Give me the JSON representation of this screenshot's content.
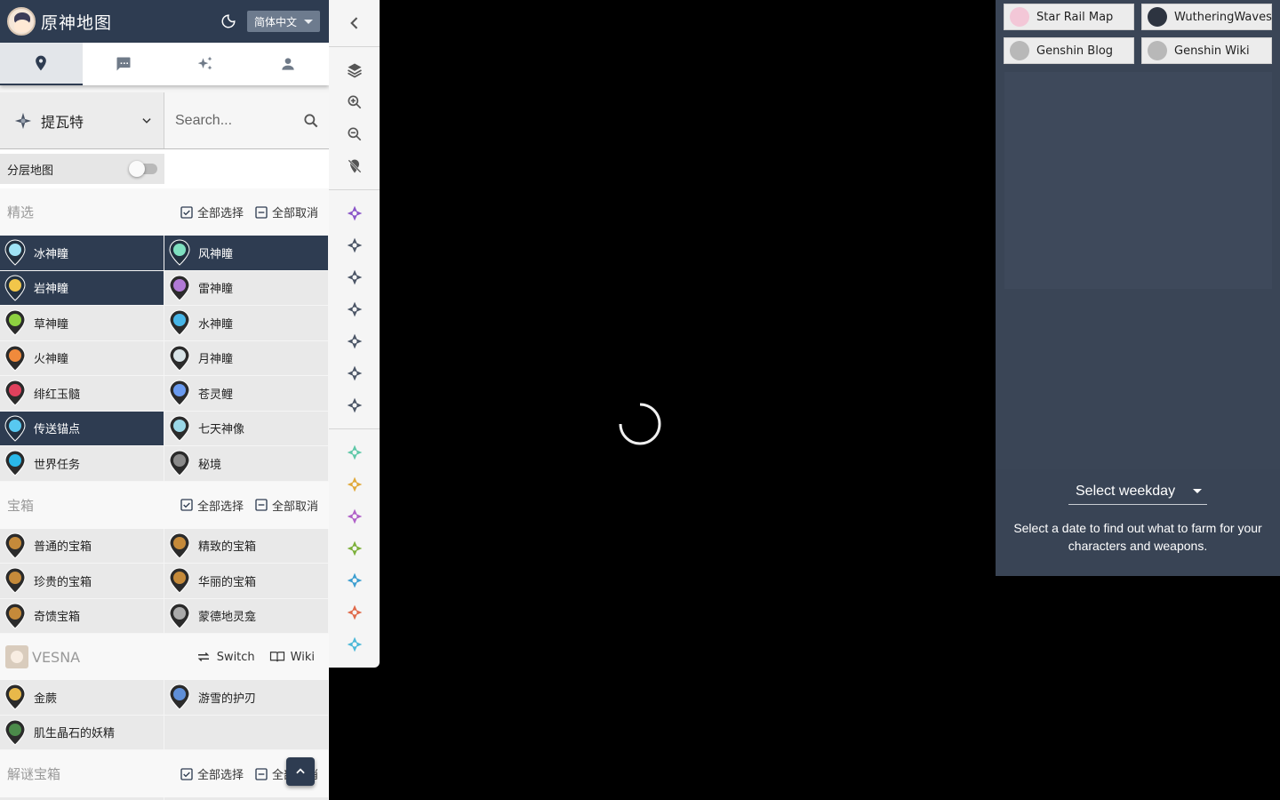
{
  "app": {
    "title": "原神地图",
    "language": "简体中文"
  },
  "tabs": [
    {
      "name": "map-pin-icon",
      "active": true
    },
    {
      "name": "chat-icon",
      "active": false
    },
    {
      "name": "sparkle-icon",
      "active": false
    },
    {
      "name": "user-icon",
      "active": false
    }
  ],
  "region": {
    "name": "提瓦特"
  },
  "search": {
    "placeholder": "Search..."
  },
  "layer_toggle": {
    "label": "分层地图",
    "on": false
  },
  "sections": {
    "featured": {
      "title": "精选",
      "select_all": "全部选择",
      "deselect_all": "全部取消",
      "items": [
        {
          "label": "冰神瞳",
          "on": true,
          "color": "#9fe3f5"
        },
        {
          "label": "风神瞳",
          "on": true,
          "color": "#7fe0c0"
        },
        {
          "label": "岩神瞳",
          "on": true,
          "color": "#f2c64a"
        },
        {
          "label": "雷神瞳",
          "on": false,
          "color": "#b17ad6"
        },
        {
          "label": "草神瞳",
          "on": false,
          "color": "#8ed140"
        },
        {
          "label": "水神瞳",
          "on": false,
          "color": "#47b6e8"
        },
        {
          "label": "火神瞳",
          "on": false,
          "color": "#f08a3c"
        },
        {
          "label": "月神瞳",
          "on": false,
          "color": "#d8e4e8"
        },
        {
          "label": "绯红玉髓",
          "on": false,
          "color": "#e0415d"
        },
        {
          "label": "苍灵鲤",
          "on": false,
          "color": "#6a9bf0"
        },
        {
          "label": "传送锚点",
          "on": true,
          "color": "#58c8f0"
        },
        {
          "label": "七天神像",
          "on": false,
          "color": "#9ad8e8"
        },
        {
          "label": "世界任务",
          "on": false,
          "color": "#2ab8e8"
        },
        {
          "label": "秘境",
          "on": false,
          "color": "#8a8a8a"
        }
      ]
    },
    "chests": {
      "title": "宝箱",
      "select_all": "全部选择",
      "deselect_all": "全部取消",
      "items": [
        {
          "label": "普通的宝箱",
          "on": false,
          "color": "#c58a3a"
        },
        {
          "label": "精致的宝箱",
          "on": false,
          "color": "#c58a3a"
        },
        {
          "label": "珍贵的宝箱",
          "on": false,
          "color": "#c58a3a"
        },
        {
          "label": "华丽的宝箱",
          "on": false,
          "color": "#c58a3a"
        },
        {
          "label": "奇馈宝箱",
          "on": false,
          "color": "#c58a3a"
        },
        {
          "label": "蒙德地灵龛",
          "on": false,
          "color": "#aaaaaa"
        }
      ]
    },
    "vesna": {
      "title": "VESNA",
      "switch_label": "Switch",
      "wiki_label": "Wiki",
      "items": [
        {
          "label": "金蕨",
          "on": false,
          "color": "#e8b84a"
        },
        {
          "label": "游雪的护刃",
          "on": false,
          "color": "#5f8fd8"
        },
        {
          "label": "肌生晶石的妖精",
          "on": false,
          "color": "#4b8a4a"
        }
      ]
    },
    "puzzle": {
      "title": "解谜宝箱",
      "select_all": "全部选择",
      "deselect_all": "全部取消"
    }
  },
  "right_panel": {
    "links": [
      {
        "label": "Star Rail Map",
        "color": "#f3c7d7"
      },
      {
        "label": "WutheringWaves",
        "color": "#2d3440"
      },
      {
        "label": "Genshin Blog",
        "color": "#b8b8b8"
      },
      {
        "label": "Genshin Wiki",
        "color": "#b8b8b8"
      }
    ],
    "weekday_placeholder": "Select weekday",
    "weekday_hint": "Select a date to find out what to farm for your characters and weapons."
  },
  "colors": {
    "primary": "#2e3c51",
    "panel": "#3a4556"
  }
}
